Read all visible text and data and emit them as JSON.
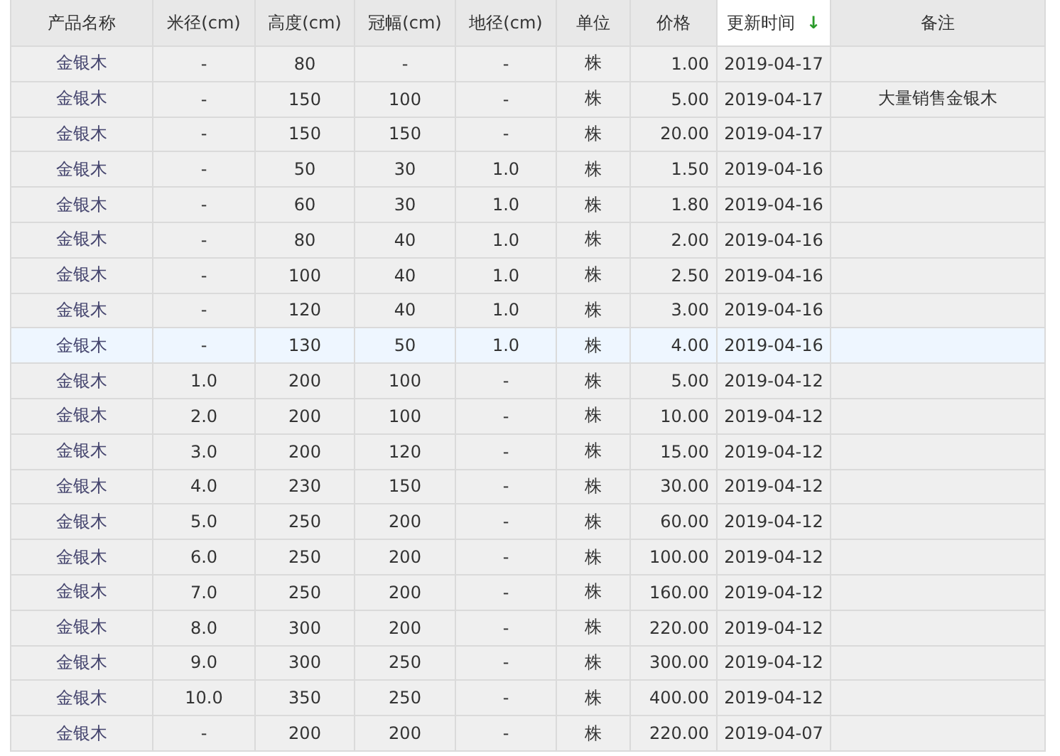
{
  "table": {
    "columns": [
      {
        "label": "产品名称",
        "sorted": false
      },
      {
        "label": "米径(cm)",
        "sorted": false
      },
      {
        "label": "高度(cm)",
        "sorted": false
      },
      {
        "label": "冠幅(cm)",
        "sorted": false
      },
      {
        "label": "地径(cm)",
        "sorted": false
      },
      {
        "label": "单位",
        "sorted": false
      },
      {
        "label": "价格",
        "sorted": false
      },
      {
        "label": "更新时间",
        "sorted": true,
        "sort_icon": "↓"
      },
      {
        "label": "备注",
        "sorted": false
      }
    ],
    "rows": [
      {
        "selected": false,
        "cells": [
          "金银木",
          "-",
          "80",
          "-",
          "-",
          "株",
          "1.00",
          "2019-04-17",
          ""
        ]
      },
      {
        "selected": false,
        "cells": [
          "金银木",
          "-",
          "150",
          "100",
          "-",
          "株",
          "5.00",
          "2019-04-17",
          "大量销售金银木"
        ]
      },
      {
        "selected": false,
        "cells": [
          "金银木",
          "-",
          "150",
          "150",
          "-",
          "株",
          "20.00",
          "2019-04-17",
          ""
        ]
      },
      {
        "selected": false,
        "cells": [
          "金银木",
          "-",
          "50",
          "30",
          "1.0",
          "株",
          "1.50",
          "2019-04-16",
          ""
        ]
      },
      {
        "selected": false,
        "cells": [
          "金银木",
          "-",
          "60",
          "30",
          "1.0",
          "株",
          "1.80",
          "2019-04-16",
          ""
        ]
      },
      {
        "selected": false,
        "cells": [
          "金银木",
          "-",
          "80",
          "40",
          "1.0",
          "株",
          "2.00",
          "2019-04-16",
          ""
        ]
      },
      {
        "selected": false,
        "cells": [
          "金银木",
          "-",
          "100",
          "40",
          "1.0",
          "株",
          "2.50",
          "2019-04-16",
          ""
        ]
      },
      {
        "selected": false,
        "cells": [
          "金银木",
          "-",
          "120",
          "40",
          "1.0",
          "株",
          "3.00",
          "2019-04-16",
          ""
        ]
      },
      {
        "selected": true,
        "cells": [
          "金银木",
          "-",
          "130",
          "50",
          "1.0",
          "株",
          "4.00",
          "2019-04-16",
          ""
        ]
      },
      {
        "selected": false,
        "cells": [
          "金银木",
          "1.0",
          "200",
          "100",
          "-",
          "株",
          "5.00",
          "2019-04-12",
          ""
        ]
      },
      {
        "selected": false,
        "cells": [
          "金银木",
          "2.0",
          "200",
          "100",
          "-",
          "株",
          "10.00",
          "2019-04-12",
          ""
        ]
      },
      {
        "selected": false,
        "cells": [
          "金银木",
          "3.0",
          "200",
          "120",
          "-",
          "株",
          "15.00",
          "2019-04-12",
          ""
        ]
      },
      {
        "selected": false,
        "cells": [
          "金银木",
          "4.0",
          "230",
          "150",
          "-",
          "株",
          "30.00",
          "2019-04-12",
          ""
        ]
      },
      {
        "selected": false,
        "cells": [
          "金银木",
          "5.0",
          "250",
          "200",
          "-",
          "株",
          "60.00",
          "2019-04-12",
          ""
        ]
      },
      {
        "selected": false,
        "cells": [
          "金银木",
          "6.0",
          "250",
          "200",
          "-",
          "株",
          "100.00",
          "2019-04-12",
          ""
        ]
      },
      {
        "selected": false,
        "cells": [
          "金银木",
          "7.0",
          "250",
          "200",
          "-",
          "株",
          "160.00",
          "2019-04-12",
          ""
        ]
      },
      {
        "selected": false,
        "cells": [
          "金银木",
          "8.0",
          "300",
          "200",
          "-",
          "株",
          "220.00",
          "2019-04-12",
          ""
        ]
      },
      {
        "selected": false,
        "cells": [
          "金银木",
          "9.0",
          "300",
          "250",
          "-",
          "株",
          "300.00",
          "2019-04-12",
          ""
        ]
      },
      {
        "selected": false,
        "cells": [
          "金银木",
          "10.0",
          "350",
          "250",
          "-",
          "株",
          "400.00",
          "2019-04-12",
          ""
        ]
      },
      {
        "selected": false,
        "cells": [
          "金银木",
          "-",
          "200",
          "200",
          "-",
          "株",
          "220.00",
          "2019-04-07",
          ""
        ]
      }
    ]
  }
}
